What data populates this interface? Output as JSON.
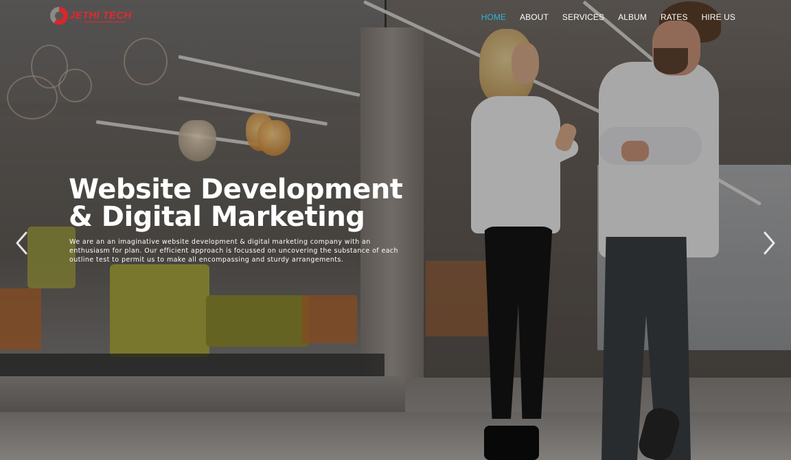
{
  "brand": {
    "name": "JETHI TECH",
    "accent_color": "#e02a2f"
  },
  "nav": {
    "items": [
      "HOME",
      "ABOUT",
      "SERVICES",
      "ALBUM",
      "RATES",
      "HIRE US"
    ],
    "active_index": 0,
    "active_color": "#2bb6d9"
  },
  "hero": {
    "title_line1": "Website Development",
    "title_line2": "& Digital Marketing",
    "description": "We are an an imaginative website development & digital marketing company with an enthusiasm for plan. Our efficient approach is focussed on uncovering the substance of each outline test to permit us to make all encompassing and sturdy arrangements.",
    "prev_icon": "chevron-left-icon",
    "next_icon": "chevron-right-icon"
  }
}
